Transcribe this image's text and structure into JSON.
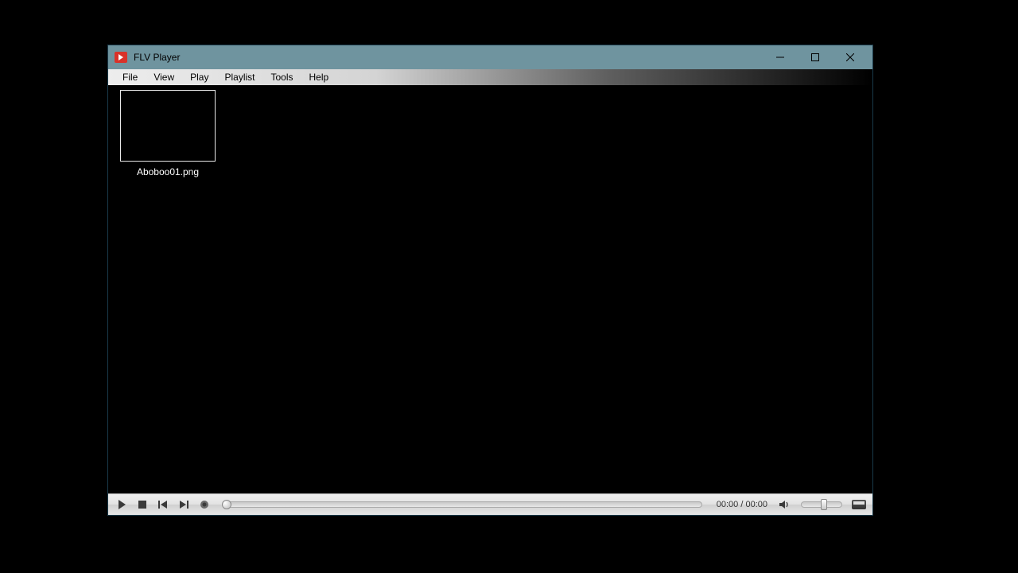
{
  "window": {
    "title": "FLV Player"
  },
  "menu": {
    "file": "File",
    "view": "View",
    "play": "Play",
    "playlist": "Playlist",
    "tools": "Tools",
    "help": "Help"
  },
  "thumb": {
    "label": "Aboboo01.png"
  },
  "controls": {
    "time_display": "00:00 / 00:00"
  }
}
